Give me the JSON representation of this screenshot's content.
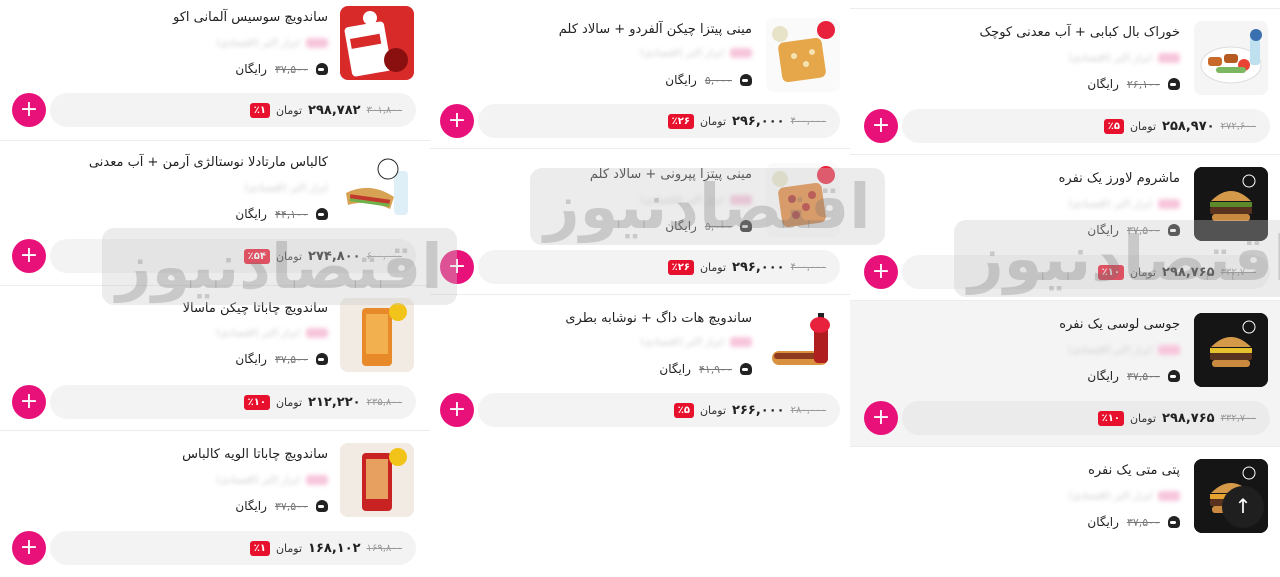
{
  "watermark": "اقتصادنیوز",
  "currency": "تومان",
  "free_label": "رایگان",
  "add_label": "+",
  "scroll_top_label": "↑",
  "blur_text": "ابزار اکبر (اقتصادی)",
  "colors": {
    "accent": "#e8117a",
    "discount": "#e8112d"
  },
  "columns": [
    {
      "items": [
        {
          "title": "خوراک بال کبابی + آب معدنی کوچک",
          "delivery_old": "۲۶,۱۰۰",
          "price": "۲۵۸,۹۷۰",
          "old_price": "۲۷۲,۶۰۰",
          "discount": "٪۵",
          "image": "kabob-plate"
        },
        {
          "title": "ماشروم لاورز یک نفره",
          "delivery_old": "۳۷,۵۰۰",
          "price": "۲۹۸,۷۶۵",
          "old_price": "۳۳۲,۷۰۰",
          "discount": "٪۱۰",
          "image": "burger"
        },
        {
          "title": "جوسی لوسی یک نفره",
          "delivery_old": "۳۷,۵۰۰",
          "price": "۲۹۸,۷۶۵",
          "old_price": "۳۳۲,۷۰۰",
          "discount": "٪۱۰",
          "image": "burger"
        },
        {
          "title": "پتی متی یک نفره",
          "delivery_old": "۳۷,۵۰۰",
          "image": "burger"
        }
      ]
    },
    {
      "items": [
        {
          "title": "مینی پیتزا چیکن آلفردو + سالاد کلم",
          "delivery_old": "۵,۰۰۰",
          "price": "۲۹۶,۰۰۰",
          "old_price": "۴۰۰,۰۰۰",
          "discount": "٪۲۶",
          "image": "pizza-alfredo"
        },
        {
          "title": "مینی پیتزا پپرونی + سالاد کلم",
          "delivery_old": "۵,۰۰۰",
          "price": "۲۹۶,۰۰۰",
          "old_price": "۴۰۰,۰۰۰",
          "discount": "٪۲۶",
          "image": "pizza-pepperoni"
        },
        {
          "title": "ساندویچ هات داگ + نوشابه بطری",
          "delivery_old": "۴۱,۹۰۰",
          "price": "۲۶۶,۰۰۰",
          "old_price": "۲۸۰,۰۰۰",
          "discount": "٪۵",
          "image": "hotdog"
        }
      ]
    },
    {
      "items": [
        {
          "title": "ساندویچ سوسیس آلمانی اکو",
          "delivery_old": "۳۷,۵۰۰",
          "price": "۲۹۸,۷۸۲",
          "old_price": "۳۰۱,۸۰۰",
          "discount": "٪۱",
          "image": "sausage-box"
        },
        {
          "title": "کالباس مارتادلا نوستالژی آرمن + آب معدنی",
          "delivery_old": "۴۴,۱۰۰",
          "price": "۲۷۴,۸۰۰",
          "old_price": "۶۰۰,۰۰۰",
          "discount": "٪۵۴",
          "image": "sandwich"
        },
        {
          "title": "ساندویچ چاباتا چیکن ماسالا",
          "delivery_old": "۳۷,۵۰۰",
          "price": "۲۱۲,۲۲۰",
          "old_price": "۲۳۵,۸۰۰",
          "discount": "٪۱۰",
          "image": "ciabatta-1"
        },
        {
          "title": "ساندویچ چاباتا الویه کالباس",
          "delivery_old": "۳۷,۵۰۰",
          "price": "۱۶۸,۱۰۲",
          "old_price": "۱۶۹,۸۰۰",
          "discount": "٪۱",
          "image": "ciabatta-2"
        }
      ]
    }
  ]
}
